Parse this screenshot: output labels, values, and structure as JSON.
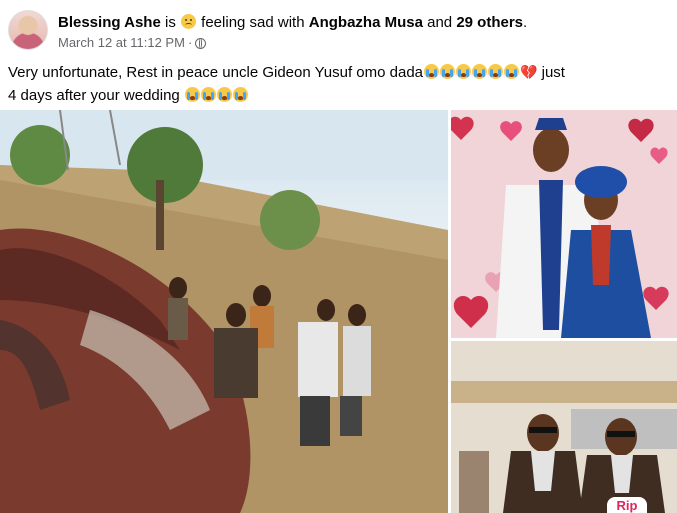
{
  "post": {
    "author": "Blessing Ashe",
    "is_text": "is",
    "feeling_text": "feeling sad with",
    "tagged": "Angbazha Musa",
    "and_text": "and",
    "others": "29 others",
    "period": ".",
    "date": "March 12 at 11:12 PM",
    "separator": "·",
    "privacy_icon": "globe-icon",
    "caption_line": "Very unfortunate, Rest in peace uncle Gideon Yusuf omo dada",
    "caption_tail": " just 4 days after your wedding"
  },
  "photos": {
    "badge_text": "Rip"
  },
  "colors": {
    "text": "#050505",
    "muted": "#65676b",
    "badge": "#e0245e"
  }
}
